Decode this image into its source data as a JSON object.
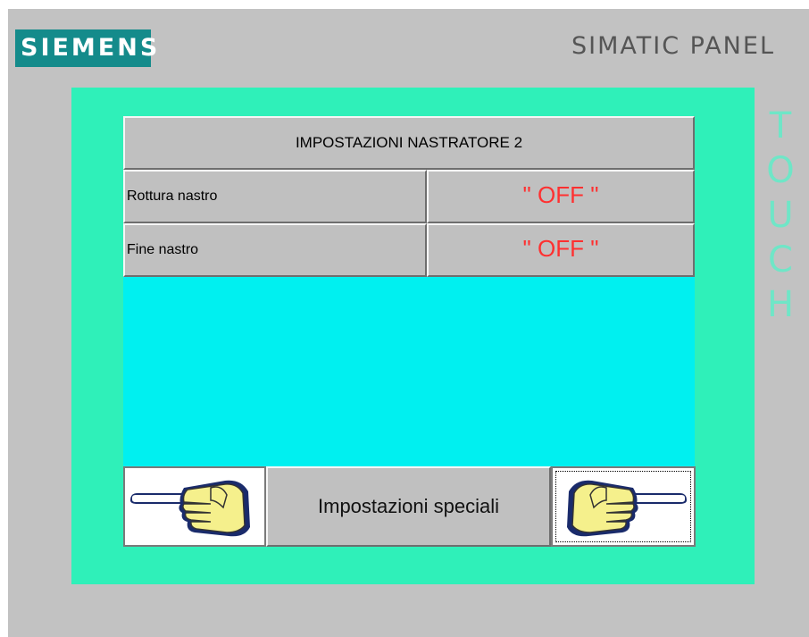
{
  "device": {
    "brand": "SIEMENS",
    "product": "SIMATIC PANEL",
    "side_label": "TOUCH"
  },
  "screen": {
    "title": "IMPOSTAZIONI NASTRATORE 2",
    "rows": [
      {
        "label": "Rottura nastro",
        "value": "\" OFF \""
      },
      {
        "label": "Fine nastro",
        "value": "\" OFF \""
      }
    ],
    "nav": {
      "prev_icon": "pointing-hand-left-icon",
      "next_icon": "pointing-hand-right-icon",
      "special_label": "Impostazioni speciali"
    }
  },
  "colors": {
    "bezel": "#c2c2c2",
    "brand_bg": "#148b8b",
    "screen_frame": "#2ff0b9",
    "screen_bg": "#00f0f0",
    "value_text": "#ff3030",
    "touch_text": "#6fe6c7"
  }
}
